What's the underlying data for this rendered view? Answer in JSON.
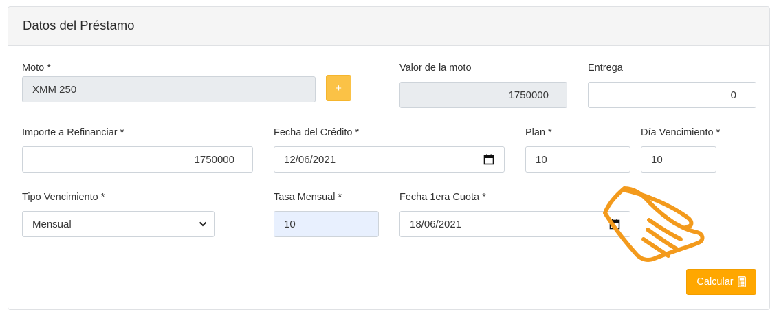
{
  "header": {
    "title": "Datos del Préstamo"
  },
  "fields": {
    "moto": {
      "label": "Moto *",
      "value": "XMM 250"
    },
    "add_button_label": "+",
    "valor_moto": {
      "label": "Valor de la moto",
      "value": "1750000"
    },
    "entrega": {
      "label": "Entrega",
      "value": "0"
    },
    "importe": {
      "label": "Importe a Refinanciar *",
      "value": "1750000"
    },
    "fecha_credito": {
      "label": "Fecha del Crédito *",
      "value": "12/06/2021"
    },
    "plan": {
      "label": "Plan *",
      "value": "10"
    },
    "dia_vencimiento": {
      "label": "Día Vencimiento *",
      "value": "10"
    },
    "tipo_vencimiento": {
      "label": "Tipo Vencimiento *",
      "value": "Mensual"
    },
    "tasa_mensual": {
      "label": "Tasa Mensual *",
      "value": "10"
    },
    "fecha_cuota": {
      "label": "Fecha 1era Cuota *",
      "value": "18/06/2021"
    }
  },
  "actions": {
    "calcular_label": "Calcular"
  },
  "icons": {
    "calendar": "calendar-icon",
    "chevron": "chevron-down-icon",
    "calculator": "calculator-icon",
    "hand": "pointing-hand-icon"
  },
  "colors": {
    "accent": "#ffa700",
    "plus_button": "#fbc246",
    "hand_stroke": "#f39a1c",
    "disabled_bg": "#e9ecef",
    "autofill_bg": "#e8f0fe"
  }
}
